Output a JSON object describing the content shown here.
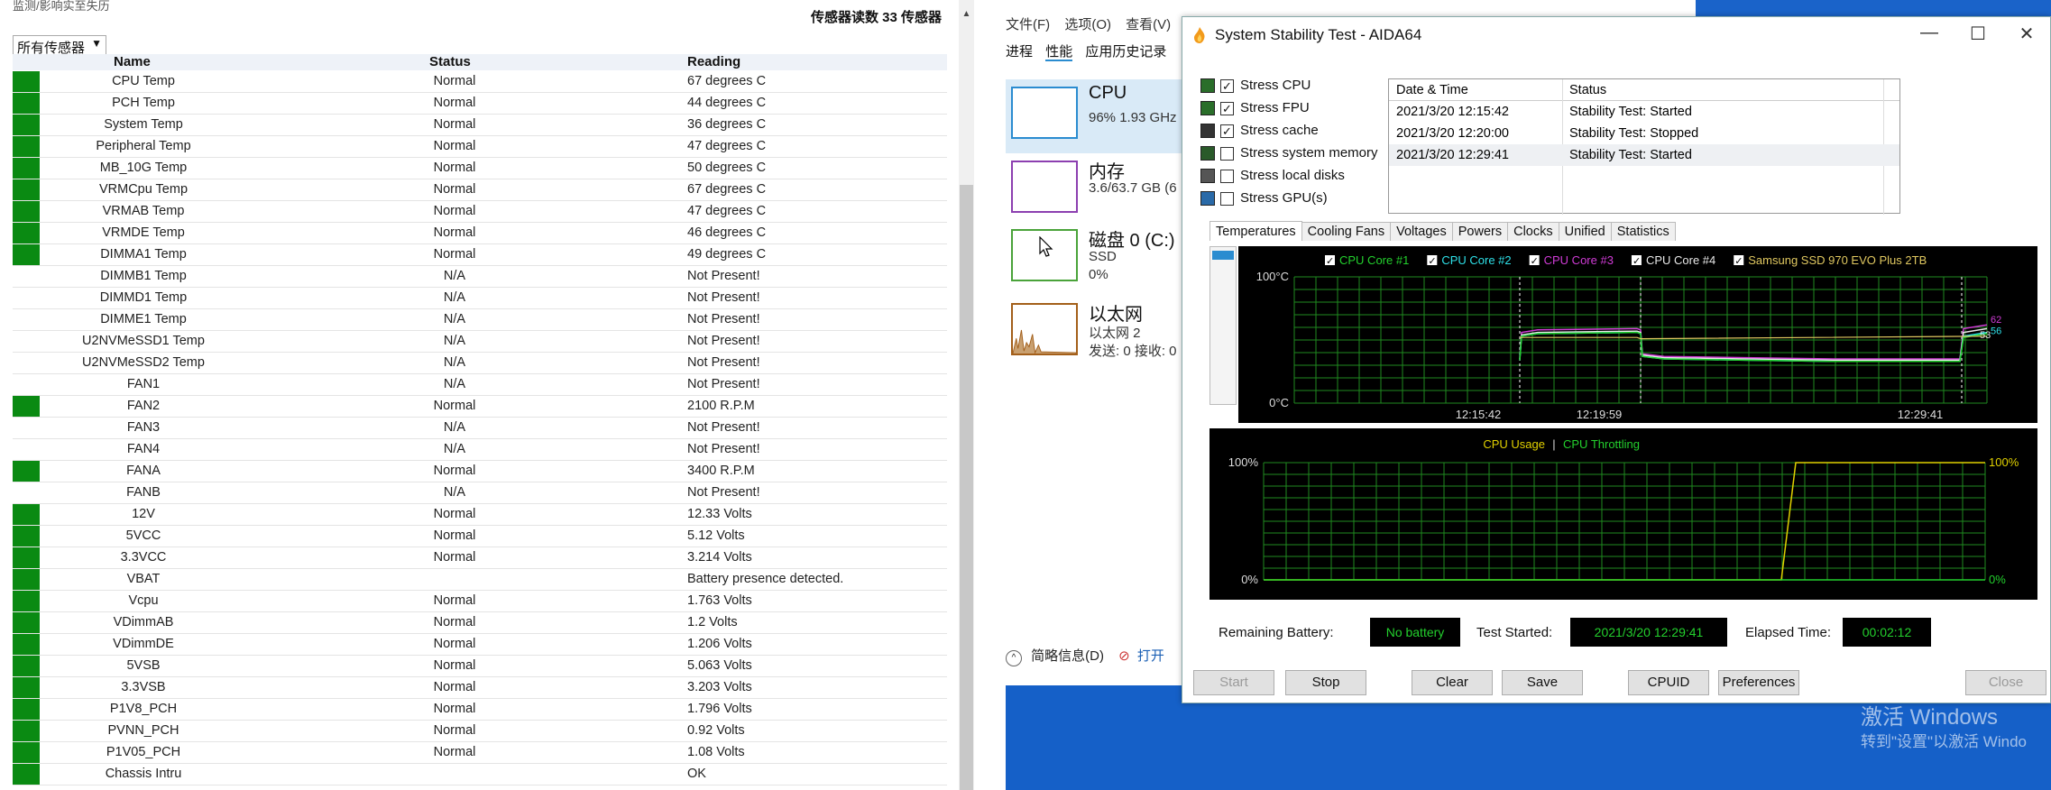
{
  "sensor_panel": {
    "breadcrumb": "监测/影响实至失历",
    "count_label": "传感器读数 33 传感器",
    "filter": "所有传感器",
    "columns": [
      "Name",
      "Status",
      "Reading"
    ],
    "rows": [
      {
        "name": "CPU Temp",
        "status": "Normal",
        "reading": "67 degrees C",
        "ok": true
      },
      {
        "name": "PCH Temp",
        "status": "Normal",
        "reading": "44 degrees C",
        "ok": true
      },
      {
        "name": "System Temp",
        "status": "Normal",
        "reading": "36 degrees C",
        "ok": true
      },
      {
        "name": "Peripheral Temp",
        "status": "Normal",
        "reading": "47 degrees C",
        "ok": true
      },
      {
        "name": "MB_10G Temp",
        "status": "Normal",
        "reading": "50 degrees C",
        "ok": true
      },
      {
        "name": "VRMCpu Temp",
        "status": "Normal",
        "reading": "67 degrees C",
        "ok": true
      },
      {
        "name": "VRMAB Temp",
        "status": "Normal",
        "reading": "47 degrees C",
        "ok": true
      },
      {
        "name": "VRMDE Temp",
        "status": "Normal",
        "reading": "46 degrees C",
        "ok": true
      },
      {
        "name": "DIMMA1 Temp",
        "status": "Normal",
        "reading": "49 degrees C",
        "ok": true
      },
      {
        "name": "DIMMB1 Temp",
        "status": "N/A",
        "reading": "Not Present!",
        "ok": false
      },
      {
        "name": "DIMMD1 Temp",
        "status": "N/A",
        "reading": "Not Present!",
        "ok": false
      },
      {
        "name": "DIMME1 Temp",
        "status": "N/A",
        "reading": "Not Present!",
        "ok": false
      },
      {
        "name": "U2NVMeSSD1 Temp",
        "status": "N/A",
        "reading": "Not Present!",
        "ok": false
      },
      {
        "name": "U2NVMeSSD2 Temp",
        "status": "N/A",
        "reading": "Not Present!",
        "ok": false
      },
      {
        "name": "FAN1",
        "status": "N/A",
        "reading": "Not Present!",
        "ok": false
      },
      {
        "name": "FAN2",
        "status": "Normal",
        "reading": "2100 R.P.M",
        "ok": true
      },
      {
        "name": "FAN3",
        "status": "N/A",
        "reading": "Not Present!",
        "ok": false
      },
      {
        "name": "FAN4",
        "status": "N/A",
        "reading": "Not Present!",
        "ok": false
      },
      {
        "name": "FANA",
        "status": "Normal",
        "reading": "3400 R.P.M",
        "ok": true
      },
      {
        "name": "FANB",
        "status": "N/A",
        "reading": "Not Present!",
        "ok": false
      },
      {
        "name": "12V",
        "status": "Normal",
        "reading": "12.33 Volts",
        "ok": true
      },
      {
        "name": "5VCC",
        "status": "Normal",
        "reading": "5.12 Volts",
        "ok": true
      },
      {
        "name": "3.3VCC",
        "status": "Normal",
        "reading": "3.214 Volts",
        "ok": true
      },
      {
        "name": "VBAT",
        "status": "",
        "reading": "Battery presence detected.",
        "ok": true
      },
      {
        "name": "Vcpu",
        "status": "Normal",
        "reading": "1.763 Volts",
        "ok": true
      },
      {
        "name": "VDimmAB",
        "status": "Normal",
        "reading": "1.2 Volts",
        "ok": true
      },
      {
        "name": "VDimmDE",
        "status": "Normal",
        "reading": "1.206 Volts",
        "ok": true
      },
      {
        "name": "5VSB",
        "status": "Normal",
        "reading": "5.063 Volts",
        "ok": true
      },
      {
        "name": "3.3VSB",
        "status": "Normal",
        "reading": "3.203 Volts",
        "ok": true
      },
      {
        "name": "P1V8_PCH",
        "status": "Normal",
        "reading": "1.796 Volts",
        "ok": true
      },
      {
        "name": "PVNN_PCH",
        "status": "Normal",
        "reading": "0.92 Volts",
        "ok": true
      },
      {
        "name": "P1V05_PCH",
        "status": "Normal",
        "reading": "1.08 Volts",
        "ok": true
      },
      {
        "name": "Chassis Intru",
        "status": "",
        "reading": "OK",
        "ok": true
      }
    ],
    "ok_color": "#0a8a12"
  },
  "task_manager": {
    "menu": [
      "文件(F)",
      "选项(O)",
      "查看(V)"
    ],
    "tabs": [
      "进程",
      "性能",
      "应用历史记录"
    ],
    "items": {
      "cpu": {
        "title": "CPU",
        "sub": "96%  1.93 GHz"
      },
      "mem": {
        "title": "内存",
        "sub": "3.6/63.7 GB (6"
      },
      "disk": {
        "title": "磁盘 0 (C:)",
        "sub1": "SSD",
        "sub2": "0%"
      },
      "net": {
        "title": "以太网",
        "sub1": "以太网 2",
        "sub2": "发送: 0  接收: 0"
      }
    },
    "footer_less": "简略信息(D)",
    "footer_open": "打开"
  },
  "desktop": {
    "activate_title": "激活 Windows",
    "activate_sub": "转到\"设置\"以激活 Windo"
  },
  "aida": {
    "title": "System Stability Test - AIDA64",
    "options": [
      {
        "label": "Stress CPU",
        "checked": true
      },
      {
        "label": "Stress FPU",
        "checked": true
      },
      {
        "label": "Stress cache",
        "checked": true
      },
      {
        "label": "Stress system memory",
        "checked": false
      },
      {
        "label": "Stress local disks",
        "checked": false
      },
      {
        "label": "Stress GPU(s)",
        "checked": false
      }
    ],
    "log_headers": [
      "Date & Time",
      "Status"
    ],
    "log": [
      {
        "time": "2021/3/20 12:15:42",
        "status": "Stability Test: Started"
      },
      {
        "time": "2021/3/20 12:20:00",
        "status": "Stability Test: Stopped"
      },
      {
        "time": "2021/3/20 12:29:41",
        "status": "Stability Test: Started"
      }
    ],
    "tabs": [
      "Temperatures",
      "Cooling Fans",
      "Voltages",
      "Powers",
      "Clocks",
      "Unified",
      "Statistics"
    ],
    "remaining_battery_label": "Remaining Battery:",
    "remaining_battery": "No battery",
    "test_started_label": "Test Started:",
    "test_started": "2021/3/20 12:29:41",
    "elapsed_label": "Elapsed Time:",
    "elapsed": "00:02:12",
    "buttons": {
      "start": "Start",
      "stop": "Stop",
      "clear": "Clear",
      "save": "Save",
      "cpuid": "CPUID",
      "prefs": "Preferences",
      "close": "Close"
    }
  },
  "chart_data": [
    {
      "type": "line",
      "legend": [
        {
          "name": "CPU Core #1",
          "color": "#23d02d",
          "checked": true
        },
        {
          "name": "CPU Core #2",
          "color": "#2ee0e8",
          "checked": true
        },
        {
          "name": "CPU Core #3",
          "color": "#d03bd6",
          "checked": true
        },
        {
          "name": "CPU Core #4",
          "color": "#e8e8e8",
          "checked": true
        },
        {
          "name": "Samsung SSD 970 EVO Plus 2TB",
          "color": "#e0c860",
          "checked": true
        }
      ],
      "ylim": [
        0,
        100
      ],
      "y_tick_labels": [
        "100°C",
        "0°C"
      ],
      "x_tick_labels": [
        "12:15:42",
        "12:19:59",
        "12:29:41"
      ],
      "end_value_labels": [
        "62",
        "56",
        "53"
      ],
      "grid": true
    },
    {
      "type": "line",
      "legend": [
        {
          "name": "CPU Usage",
          "color": "#e0d000"
        },
        {
          "name": "CPU Throttling",
          "color": "#23d02d"
        }
      ],
      "ylim": [
        0,
        100
      ],
      "y_tick_labels_left": [
        "100%",
        "0%"
      ],
      "y_tick_labels_right": [
        "100%",
        "0%"
      ],
      "grid": true
    }
  ]
}
